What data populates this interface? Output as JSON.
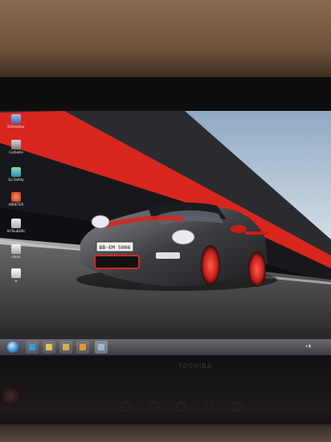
{
  "desktop": {
    "icons": [
      {
        "label": "Ordinateur",
        "icon": "computer-icon"
      },
      {
        "label": "Corbeille",
        "icon": "recycle-bin-icon"
      },
      {
        "label": "Go Safety",
        "icon": "app-icon"
      },
      {
        "label": "ARRETER",
        "icon": "shutdown-icon"
      },
      {
        "label": "AUTouBURc",
        "icon": "shortcut-icon"
      },
      {
        "label": "clean",
        "icon": "shortcut-icon"
      },
      {
        "label": "w",
        "icon": "document-icon"
      }
    ],
    "wallpaper": {
      "plate_text": "BB·EM 5006",
      "accent_red": "#d8261f",
      "car_body": "#3a3b3e",
      "sky": "#c9d6e0"
    }
  },
  "taskbar": {
    "pinned": [
      {
        "name": "internet-explorer-icon",
        "color": "#3b9ae0"
      },
      {
        "name": "folder-icon",
        "color": "#e6c25a"
      },
      {
        "name": "folder-icon",
        "color": "#d6b04a"
      },
      {
        "name": "media-icon",
        "color": "#e29a2c"
      },
      {
        "name": "window-icon",
        "color": "#9ab8d8"
      }
    ]
  },
  "laptop": {
    "brand": "TOSHIBA"
  }
}
